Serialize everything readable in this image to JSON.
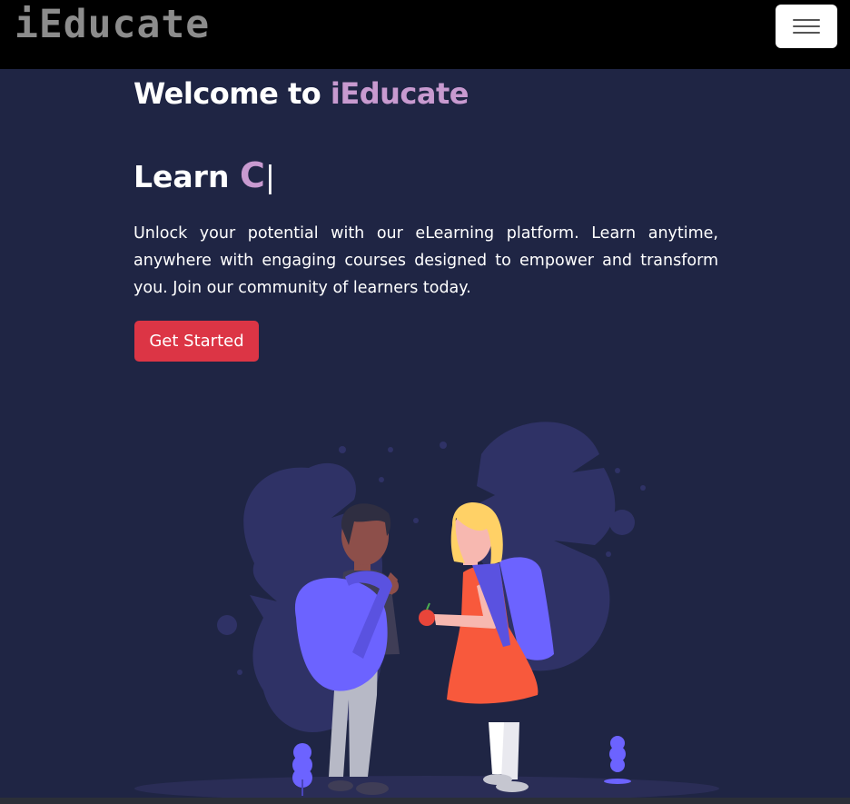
{
  "navbar": {
    "brand": "iEducate",
    "toggler_icon": "hamburger-menu-icon"
  },
  "hero": {
    "welcome_prefix": "Welcome to ",
    "welcome_brand": "iEducate",
    "learn_prefix": "Learn ",
    "learn_typed": "C",
    "learn_cursor": "|",
    "description": "Unlock your potential with our eLearning platform. Learn anytime, anywhere with engaging courses designed to empower and transform you. Join our community of learners today.",
    "cta_label": "Get Started"
  },
  "illustration": {
    "icon": "students-with-backpacks-illustration"
  },
  "colors": {
    "background": "#1f2544",
    "navbar": "#000000",
    "accent": "#c89ad0",
    "cta": "#dc3545",
    "blob": "#2f3266",
    "backpack": "#6c63ff",
    "dress": "#f8593c"
  }
}
